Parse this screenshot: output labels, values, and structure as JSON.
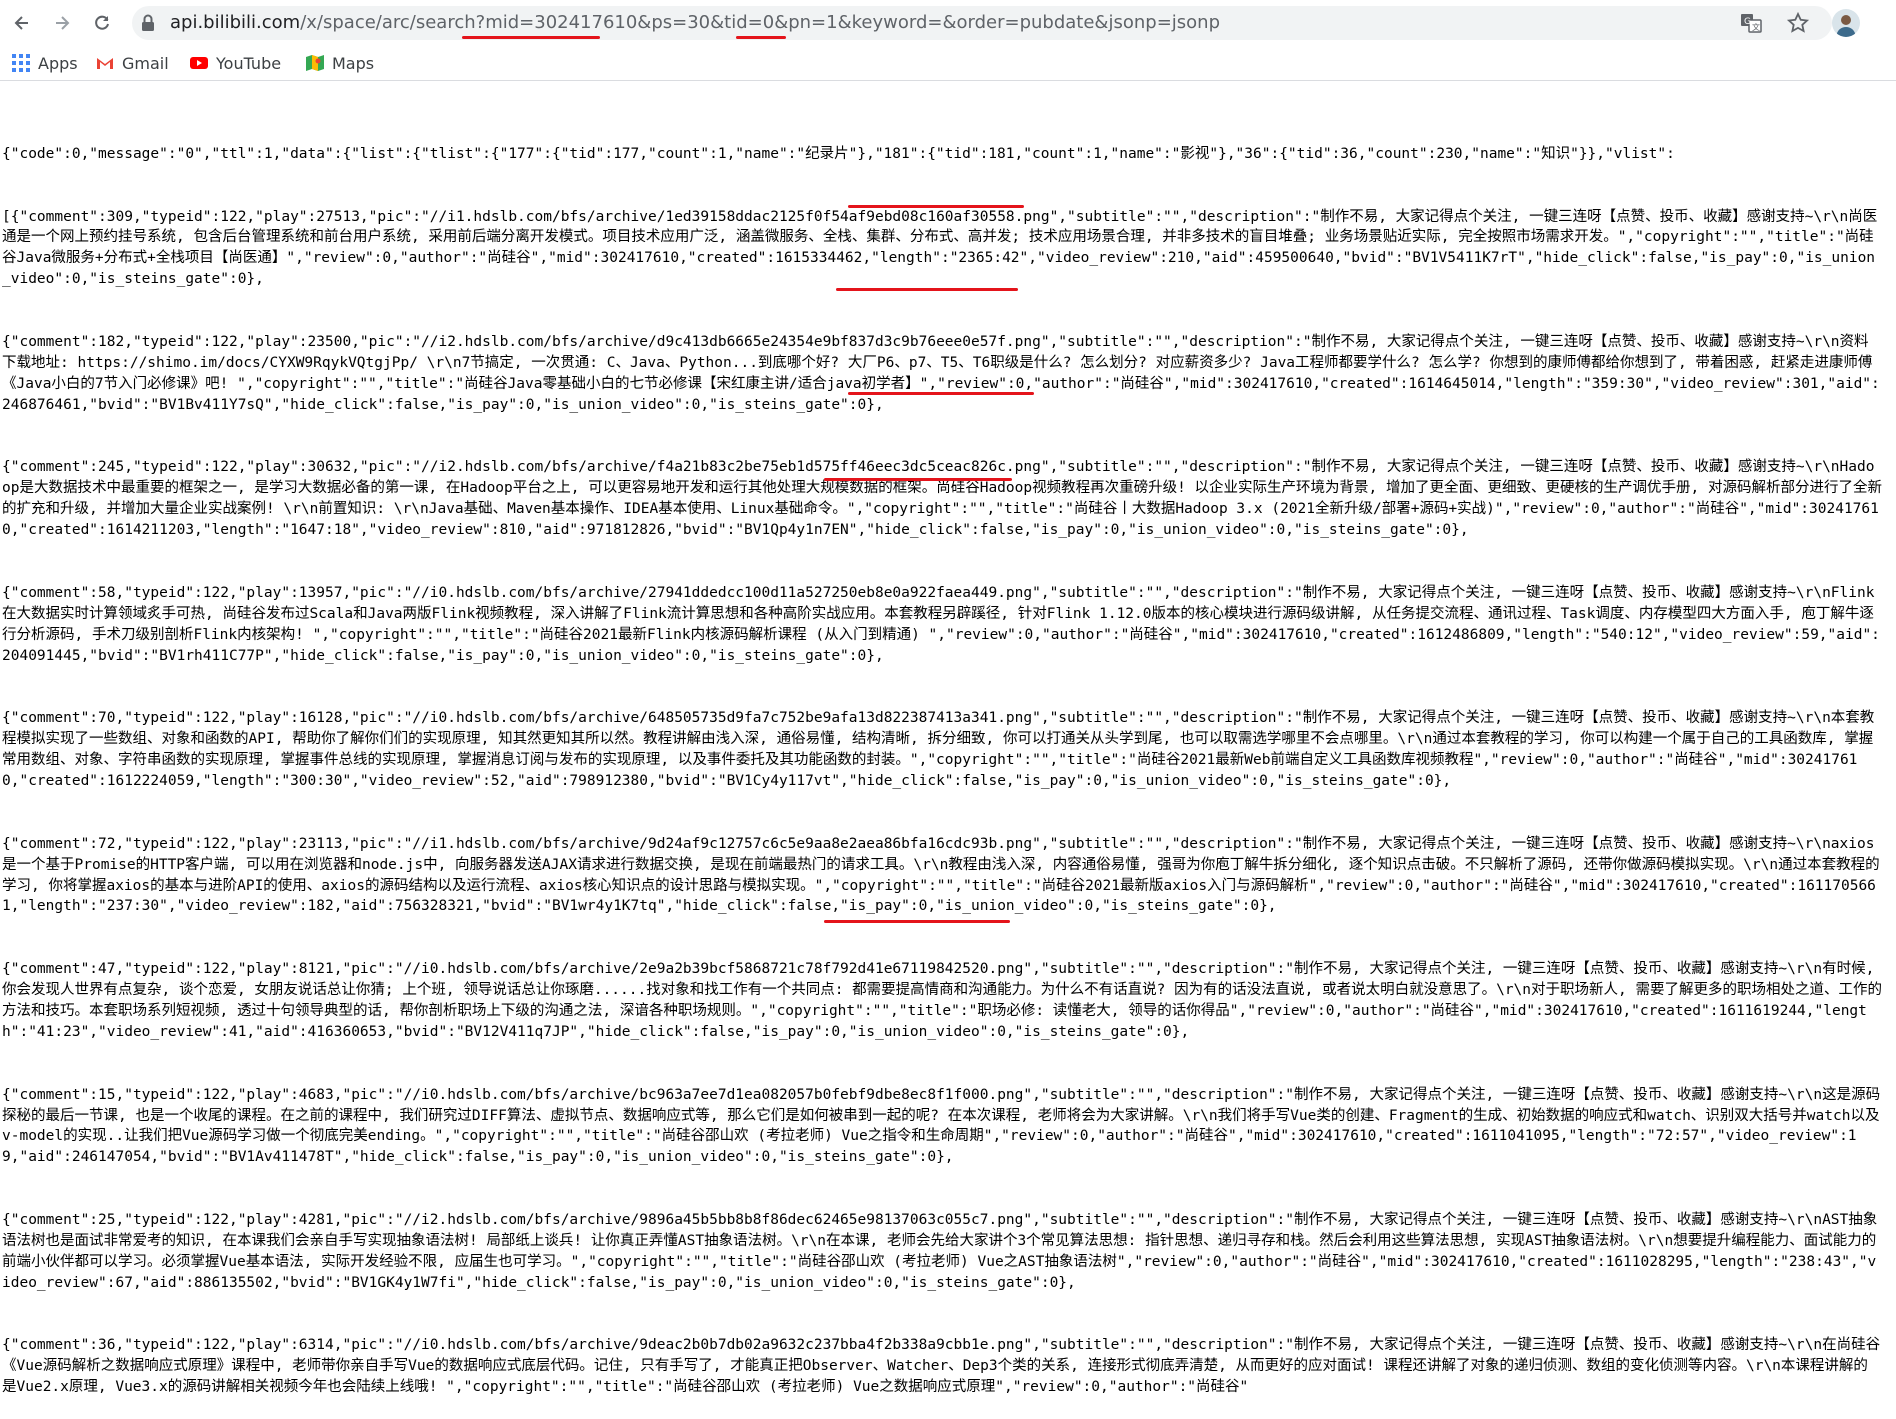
{
  "browser": {
    "url_host": "api.bilibili.com",
    "url_path": "/x/space/arc/search?mid=302417610&ps=30&tid=0&pn=1&keyword=&order=pubdate&jsonp=jsonp",
    "bookmarks": [
      {
        "label": "Apps",
        "icon": "apps-grid-icon"
      },
      {
        "label": "Gmail",
        "icon": "gmail-icon"
      },
      {
        "label": "YouTube",
        "icon": "youtube-icon"
      },
      {
        "label": "Maps",
        "icon": "maps-icon"
      }
    ],
    "icons": [
      "back-arrow-icon",
      "forward-arrow-icon",
      "reload-icon",
      "lock-icon",
      "translate-icon",
      "star-icon",
      "avatar-icon"
    ]
  },
  "colors": {
    "annotation": "#e4141b"
  },
  "json_lines": [
    "{\"code\":0,\"message\":\"0\",\"ttl\":1,\"data\":{\"list\":{\"tlist\":{\"177\":{\"tid\":177,\"count\":1,\"name\":\"纪录片\"},\"181\":{\"tid\":181,\"count\":1,\"name\":\"影视\"},\"36\":{\"tid\":36,\"count\":230,\"name\":\"知识\"}},\"vlist\":",
    "[{\"comment\":309,\"typeid\":122,\"play\":27513,\"pic\":\"//i1.hdslb.com/bfs/archive/1ed39158ddac2125f0f54af9ebd08c160af30558.png\",\"subtitle\":\"\",\"description\":\"制作不易, 大家记得点个关注, 一键三连呀【点赞、投币、收藏】感谢支持~\\r\\n尚医通是一个网上预约挂号系统, 包含后台管理系统和前台用户系统, 采用前后端分离开发模式。项目技术应用广泛, 涵盖微服务、全栈、集群、分布式、高并发; 技术应用场景合理, 并非多技术的盲目堆叠; 业务场景贴近实际, 完全按照市场需求开发。\",\"copyright\":\"\",\"title\":\"尚硅谷Java微服务+分布式+全栈项目【尚医通】\",\"review\":0,\"author\":\"尚硅谷\",\"mid\":302417610,\"created\":1615334462,\"length\":\"2365:42\",\"video_review\":210,\"aid\":459500640,\"bvid\":\"BV1V5411K7rT\",\"hide_click\":false,\"is_pay\":0,\"is_union_video\":0,\"is_steins_gate\":0},",
    "{\"comment\":182,\"typeid\":122,\"play\":23500,\"pic\":\"//i2.hdslb.com/bfs/archive/d9c413db6665e24354e9bf837d3c9b76eee0e57f.png\",\"subtitle\":\"\",\"description\":\"制作不易, 大家记得点个关注, 一键三连呀【点赞、投币、收藏】感谢支持~\\r\\n资料下载地址: https://shimo.im/docs/CYXW9RqykVQtgjPp/ \\r\\n7节搞定, 一次贯通: C、Java、Python...到底哪个好? 大厂P6、p7、T5、T6职级是什么? 怎么划分? 对应薪资多少? Java工程师都要学什么? 怎么学? 你想到的康师傅都给你想到了, 带着困惑, 赶紧走进康师傅《Java小白的7节入门必修课》吧! \",\"copyright\":\"\",\"title\":\"尚硅谷Java零基础小白的七节必修课【宋红康主讲/适合java初学者】\",\"review\":0,\"author\":\"尚硅谷\",\"mid\":302417610,\"created\":1614645014,\"length\":\"359:30\",\"video_review\":301,\"aid\":246876461,\"bvid\":\"BV1Bv411Y7sQ\",\"hide_click\":false,\"is_pay\":0,\"is_union_video\":0,\"is_steins_gate\":0},",
    "{\"comment\":245,\"typeid\":122,\"play\":30632,\"pic\":\"//i2.hdslb.com/bfs/archive/f4a21b83c2be75eb1d575ff46eec3dc5ceac826c.png\",\"subtitle\":\"\",\"description\":\"制作不易, 大家记得点个关注, 一键三连呀【点赞、投币、收藏】感谢支持~\\r\\nHadoop是大数据技术中最重要的框架之一, 是学习大数据必备的第一课, 在Hadoop平台之上, 可以更容易地开发和运行其他处理大规模数据的框架。尚硅谷Hadoop视频教程再次重磅升级! 以企业实际生产环境为背景, 增加了更全面、更细致、更硬核的生产调优手册, 对源码解析部分进行了全新的扩充和升级, 并增加大量企业实战案例! \\r\\n前置知识: \\r\\nJava基础、Maven基本操作、IDEA基本使用、Linux基础命令。\",\"copyright\":\"\",\"title\":\"尚硅谷丨大数据Hadoop 3.x (2021全新升级/部署+源码+实战)\",\"review\":0,\"author\":\"尚硅谷\",\"mid\":302417610,\"created\":1614211203,\"length\":\"1647:18\",\"video_review\":810,\"aid\":971812826,\"bvid\":\"BV1Qp4y1n7EN\",\"hide_click\":false,\"is_pay\":0,\"is_union_video\":0,\"is_steins_gate\":0},",
    "{\"comment\":58,\"typeid\":122,\"play\":13957,\"pic\":\"//i0.hdslb.com/bfs/archive/27941ddedcc100d11a527250eb8e0a922faea449.png\",\"subtitle\":\"\",\"description\":\"制作不易, 大家记得点个关注, 一键三连呀【点赞、投币、收藏】感谢支持~\\r\\nFlink在大数据实时计算领域炙手可热, 尚硅谷发布过Scala和Java两版Flink视频教程, 深入讲解了Flink流计算思想和各种高阶实战应用。本套教程另辟蹊径, 针对Flink 1.12.0版本的核心模块进行源码级讲解, 从任务提交流程、通讯过程、Task调度、内存模型四大方面入手, 庖丁解牛逐行分析源码, 手术刀级别剖析Flink内核架构! \",\"copyright\":\"\",\"title\":\"尚硅谷2021最新Flink内核源码解析课程 (从入门到精通) \",\"review\":0,\"author\":\"尚硅谷\",\"mid\":302417610,\"created\":1612486809,\"length\":\"540:12\",\"video_review\":59,\"aid\":204091445,\"bvid\":\"BV1rh411C77P\",\"hide_click\":false,\"is_pay\":0,\"is_union_video\":0,\"is_steins_gate\":0},",
    "{\"comment\":70,\"typeid\":122,\"play\":16128,\"pic\":\"//i0.hdslb.com/bfs/archive/648505735d9fa7c752be9afa13d822387413a341.png\",\"subtitle\":\"\",\"description\":\"制作不易, 大家记得点个关注, 一键三连呀【点赞、投币、收藏】感谢支持~\\r\\n本套教程模拟实现了一些数组、对象和函数的API, 帮助你了解你们们的实现原理, 知其然更知其所以然。教程讲解由浅入深, 通俗易懂, 结构清晰, 拆分细致, 你可以打通关从头学到尾, 也可以取需选学哪里不会点哪里。\\r\\n通过本套教程的学习, 你可以构建一个属于自己的工具函数库, 掌握常用数组、对象、字符串函数的实现原理, 掌握事件总线的实现原理, 掌握消息订阅与发布的实现原理, 以及事件委托及其功能函数的封装。\",\"copyright\":\"\",\"title\":\"尚硅谷2021最新Web前端自定义工具函数库视频教程\",\"review\":0,\"author\":\"尚硅谷\",\"mid\":302417610,\"created\":1612224059,\"length\":\"300:30\",\"video_review\":52,\"aid\":798912380,\"bvid\":\"BV1Cy4y117vt\",\"hide_click\":false,\"is_pay\":0,\"is_union_video\":0,\"is_steins_gate\":0},",
    "{\"comment\":72,\"typeid\":122,\"play\":23113,\"pic\":\"//i1.hdslb.com/bfs/archive/9d24af9c12757c6c5e9aa8e2aea86bfa16cdc93b.png\",\"subtitle\":\"\",\"description\":\"制作不易, 大家记得点个关注, 一键三连呀【点赞、投币、收藏】感谢支持~\\r\\naxios是一个基于Promise的HTTP客户端, 可以用在浏览器和node.js中, 向服务器发送AJAX请求进行数据交换, 是现在前端最热门的请求工具。\\r\\n教程由浅入深, 内容通俗易懂, 强哥为你庖丁解牛拆分细化, 逐个知识点击破。不只解析了源码, 还带你做源码模拟实现。\\r\\n通过本套教程的学习, 你将掌握axios的基本与进阶API的使用、axios的源码结构以及运行流程、axios核心知识点的设计思路与模拟实现。\",\"copyright\":\"\",\"title\":\"尚硅谷2021最新版axios入门与源码解析\",\"review\":0,\"author\":\"尚硅谷\",\"mid\":302417610,\"created\":1611705661,\"length\":\"237:30\",\"video_review\":182,\"aid\":756328321,\"bvid\":\"BV1wr4y1K7tq\",\"hide_click\":false,\"is_pay\":0,\"is_union_video\":0,\"is_steins_gate\":0},",
    "{\"comment\":47,\"typeid\":122,\"play\":8121,\"pic\":\"//i0.hdslb.com/bfs/archive/2e9a2b39bcf5868721c78f792d41e67119842520.png\",\"subtitle\":\"\",\"description\":\"制作不易, 大家记得点个关注, 一键三连呀【点赞、投币、收藏】感谢支持~\\r\\n有时候, 你会发现人世界有点复杂, 谈个恋爱, 女朋友说话总让你猜; 上个班, 领导说话总让你琢磨......找对象和找工作有一个共同点: 都需要提高情商和沟通能力。为什么不有话直说? 因为有的话没法直说, 或者说太明白就没意思了。\\r\\n对于职场新人, 需要了解更多的职场相处之道、工作的方法和技巧。本套职场系列短视频, 透过十句领导典型的话, 帮你剖析职场上下级的沟通之法, 深谙各种职场规则。\",\"copyright\":\"\",\"title\":\"职场必修: 读懂老大, 领导的话你得品\",\"review\":0,\"author\":\"尚硅谷\",\"mid\":302417610,\"created\":1611619244,\"length\":\"41:23\",\"video_review\":41,\"aid\":416360653,\"bvid\":\"BV12V411q7JP\",\"hide_click\":false,\"is_pay\":0,\"is_union_video\":0,\"is_steins_gate\":0},",
    "{\"comment\":15,\"typeid\":122,\"play\":4683,\"pic\":\"//i0.hdslb.com/bfs/archive/bc963a7ee7d1ea082057b0febf9dbe8ec8f1f000.png\",\"subtitle\":\"\",\"description\":\"制作不易, 大家记得点个关注, 一键三连呀【点赞、投币、收藏】感谢支持~\\r\\n这是源码探秘的最后一节课, 也是一个收尾的课程。在之前的课程中, 我们研究过DIFF算法、虚拟节点、数据响应式等, 那么它们是如何被串到一起的呢? 在本次课程, 老师将会为大家讲解。\\r\\n我们将手写Vue类的创建、Fragment的生成、初始数据的响应式和watch、识别双大括号并watch以及v-model的实现..让我们把Vue源码学习做一个彻底完美ending。\",\"copyright\":\"\",\"title\":\"尚硅谷邵山欢 (考拉老师) Vue之指令和生命周期\",\"review\":0,\"author\":\"尚硅谷\",\"mid\":302417610,\"created\":1611041095,\"length\":\"72:57\",\"video_review\":19,\"aid\":246147054,\"bvid\":\"BV1Av411478T\",\"hide_click\":false,\"is_pay\":0,\"is_union_video\":0,\"is_steins_gate\":0},",
    "{\"comment\":25,\"typeid\":122,\"play\":4281,\"pic\":\"//i2.hdslb.com/bfs/archive/9896a45b5bb8b8f86dec62465e98137063c055c7.png\",\"subtitle\":\"\",\"description\":\"制作不易, 大家记得点个关注, 一键三连呀【点赞、投币、收藏】感谢支持~\\r\\nAST抽象语法树也是面试非常爱考的知识, 在本课我们会亲自手写实现抽象语法树! 局部纸上谈兵! 让你真正弄懂AST抽象语法树。\\r\\n在本课, 老师会先给大家讲个3个常见算法思想: 指针思想、递归寻存和栈。然后会利用这些算法思想, 实现AST抽象语法树。\\r\\n想要提升编程能力、面试能力的前端小伙伴都可以学习。必须掌握Vue基本语法, 实际开发经验不限, 应届生也可学习。\",\"copyright\":\"\",\"title\":\"尚硅谷邵山欢 (考拉老师) Vue之AST抽象语法树\",\"review\":0,\"author\":\"尚硅谷\",\"mid\":302417610,\"created\":1611028295,\"length\":\"238:43\",\"video_review\":67,\"aid\":886135502,\"bvid\":\"BV1GK4y1W7fi\",\"hide_click\":false,\"is_pay\":0,\"is_union_video\":0,\"is_steins_gate\":0},",
    "{\"comment\":36,\"typeid\":122,\"play\":6314,\"pic\":\"//i0.hdslb.com/bfs/archive/9deac2b0b7db02a9632c237bba4f2b338a9cbb1e.png\",\"subtitle\":\"\",\"description\":\"制作不易, 大家记得点个关注, 一键三连呀【点赞、投币、收藏】感谢支持~\\r\\n在尚硅谷《Vue源码解析之数据响应式原理》课程中, 老师带你亲自手写Vue的数据响应式底层代码。记住, 只有手写了, 才能真正把Observer、Watcher、Dep3个类的关系, 连接形式彻底弄清楚, 从而更好的应对面试! 课程还讲解了对象的递归侦测、数组的变化侦测等内容。\\r\\n本课程讲解的是Vue2.x原理, Vue3.x的源码讲解相关视频今年也会陆续上线哦! \",\"copyright\":\"\",\"title\":\"尚硅谷邵山欢 (考拉老师) Vue之数据响应式原理\",\"review\":0,\"author\":\"尚硅谷\""
  ]
}
